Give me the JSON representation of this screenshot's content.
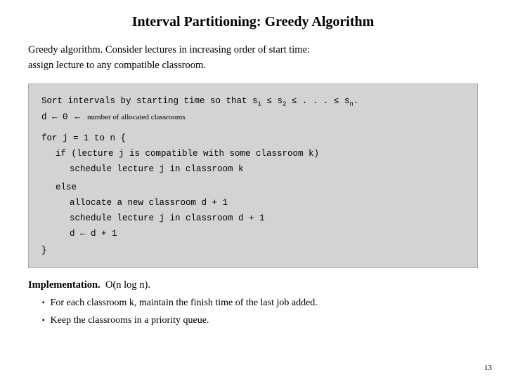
{
  "title": "Interval Partitioning:  Greedy Algorithm",
  "intro": {
    "line1": "Greedy algorithm.  Consider lectures in increasing order of start time:",
    "line2": "assign lecture to any compatible classroom."
  },
  "code": {
    "sort_line": "Sort intervals by starting time so that s",
    "sort_subscripts": [
      "1",
      "2",
      "n"
    ],
    "sort_annotation": "number of allocated classrooms",
    "d_line": "d ← 0",
    "for_line": "for j = 1 to n {",
    "if_line": "if (lecture j is compatible with some classroom k)",
    "schedule1": "schedule lecture j in classroom k",
    "else_line": "else",
    "allocate_line": "allocate a new classroom d + 1",
    "schedule2": "schedule lecture j in classroom d + 1",
    "d_update": "d ← d + 1",
    "close_brace": "}"
  },
  "implementation": {
    "heading": "Implementation.",
    "complexity": "O(n log n).",
    "bullets": [
      "For each classroom k, maintain the finish time of the last job added.",
      "Keep the classrooms in a priority queue."
    ]
  },
  "page_number": "13"
}
